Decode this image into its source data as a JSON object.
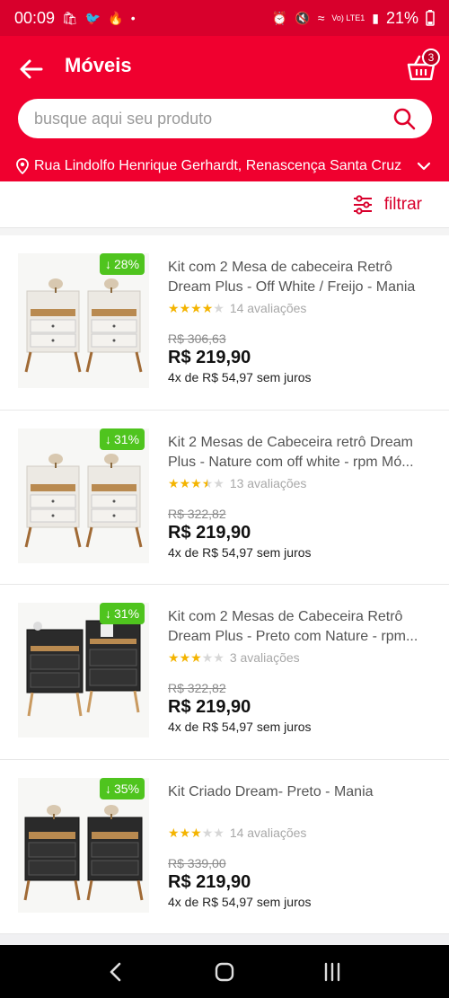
{
  "status_bar": {
    "time": "00:09",
    "battery": "21%",
    "network": "Vo) LTE1"
  },
  "header": {
    "title": "Móveis",
    "cart_count": "3"
  },
  "search": {
    "placeholder": "busque aqui seu produto"
  },
  "address": {
    "text": "Rua Lindolfo Henrique Gerhardt, Renascença Santa Cruz"
  },
  "filter": {
    "label": "filtrar"
  },
  "colors": {
    "brand_red": "#f0002f",
    "discount_green": "#4fc41e",
    "star_yellow": "#f4b400"
  },
  "products": [
    {
      "name": "Kit com 2 Mesa de cabeceira Retrô Dream Plus - Off White / Freijo - Mania",
      "discount": "28%",
      "rating": 4,
      "reviews": "14 avaliações",
      "old_price": "R$ 306,63",
      "price": "R$ 219,90",
      "installments": "4x de R$ 54,97 sem juros",
      "finish": "white"
    },
    {
      "name": "Kit 2 Mesas de Cabeceira retrô Dream Plus - Nature com off white - rpm Mó...",
      "discount": "31%",
      "rating": 3.5,
      "reviews": "13 avaliações",
      "old_price": "R$ 322,82",
      "price": "R$ 219,90",
      "installments": "4x de R$ 54,97 sem juros",
      "finish": "white"
    },
    {
      "name": "Kit com 2 Mesas de Cabeceira Retrô Dream Plus - Preto com Nature - rpm...",
      "discount": "31%",
      "rating": 3,
      "reviews": "3 avaliações",
      "old_price": "R$ 322,82",
      "price": "R$ 219,90",
      "installments": "4x de R$ 54,97 sem juros",
      "finish": "black"
    },
    {
      "name": "Kit Criado Dream- Preto - Mania",
      "discount": "35%",
      "rating": 3,
      "reviews": "14 avaliações",
      "old_price": "R$ 339,00",
      "price": "R$ 219,90",
      "installments": "4x de R$ 54,97 sem juros",
      "finish": "black"
    }
  ]
}
